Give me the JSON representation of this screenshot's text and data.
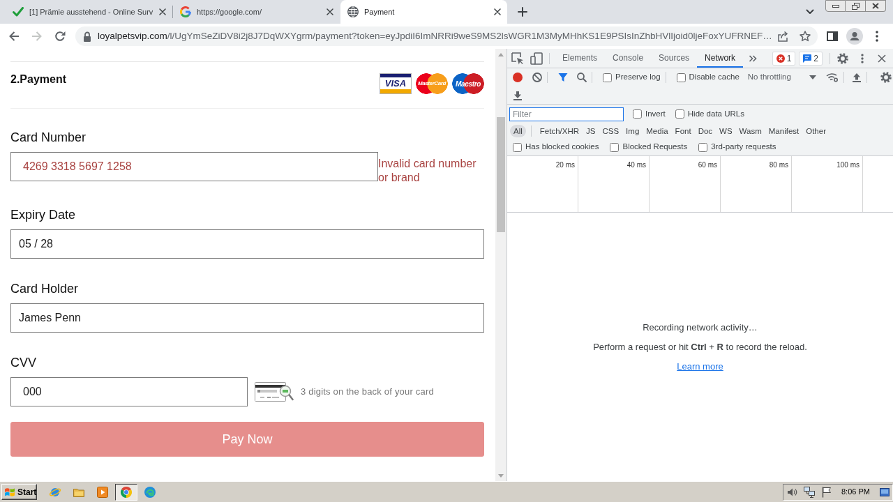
{
  "browser": {
    "tabs": [
      {
        "title": "[1] Prämie ausstehend - Online Surv",
        "kind": "check",
        "selected": false
      },
      {
        "title": "https://google.com/",
        "kind": "google",
        "selected": false
      },
      {
        "title": "Payment",
        "kind": "globe",
        "selected": true
      }
    ],
    "nav_buttons": [
      {
        "kind": "back",
        "disabled": false
      },
      {
        "kind": "forward",
        "disabled": true
      },
      {
        "kind": "reload",
        "disabled": false
      }
    ],
    "address": {
      "host": "loyalpetsvip.com",
      "path": "/l/UgYmSeZiDV8i2j8J7DqWXYgrm/payment?token=eyJpdiI6ImNRRi9weS9MS2lsWGR1M3MyMHhKS1E9PSIsInZhbHVlIjoid0ljeFoxYUFRNEF…"
    }
  },
  "page": {
    "section_title": "2.Payment",
    "card_logos": [
      {
        "kind": "visa",
        "label": "VISA"
      },
      {
        "kind": "mastercard",
        "label": "MasterCard"
      },
      {
        "kind": "maestro",
        "label": "Maestro"
      }
    ],
    "fields": [
      {
        "label": "Card Number",
        "value": "4269 3318 5697 1258",
        "invalid": true,
        "error": "Invalid card number or brand"
      },
      {
        "label": "Expiry Date",
        "value": "05 / 28",
        "invalid": false
      },
      {
        "label": "Card Holder",
        "value": "James Penn",
        "invalid": false
      },
      {
        "label": "CVV",
        "value": "000",
        "invalid": false,
        "hint": "3 digits on the back of your card"
      }
    ],
    "pay_button": {
      "label": "Pay Now",
      "disabled": true
    }
  },
  "devtools": {
    "tabs": [
      {
        "label": "Elements",
        "selected": false
      },
      {
        "label": "Console",
        "selected": false
      },
      {
        "label": "Sources",
        "selected": false
      },
      {
        "label": "Network",
        "selected": true
      }
    ],
    "issues": {
      "errors": "1",
      "messages": "2"
    },
    "toolbar": {
      "checkboxes": [
        {
          "label": "Preserve log",
          "checked": false
        },
        {
          "label": "Disable cache",
          "checked": false
        }
      ],
      "throttling": "No throttling"
    },
    "filter": {
      "placeholder": "Filter",
      "options": [
        {
          "label": "Invert",
          "checked": false
        },
        {
          "label": "Hide data URLs",
          "checked": false
        }
      ]
    },
    "types": [
      {
        "label": "All",
        "selected": true
      },
      {
        "label": "Fetch/XHR",
        "selected": false
      },
      {
        "label": "JS",
        "selected": false
      },
      {
        "label": "CSS",
        "selected": false
      },
      {
        "label": "Img",
        "selected": false
      },
      {
        "label": "Media",
        "selected": false
      },
      {
        "label": "Font",
        "selected": false
      },
      {
        "label": "Doc",
        "selected": false
      },
      {
        "label": "WS",
        "selected": false
      },
      {
        "label": "Wasm",
        "selected": false
      },
      {
        "label": "Manifest",
        "selected": false
      },
      {
        "label": "Other",
        "selected": false
      }
    ],
    "request_filters": [
      {
        "label": "Has blocked cookies",
        "checked": false
      },
      {
        "label": "Blocked Requests",
        "checked": false
      },
      {
        "label": "3rd-party requests",
        "checked": false
      }
    ],
    "timeline": {
      "ticks": [
        "20 ms",
        "40 ms",
        "60 ms",
        "80 ms",
        "100 ms"
      ]
    },
    "empty_state": {
      "title": "Recording network activity…",
      "hint": "Perform a request or hit **Ctrl** + **R** to record the reload.",
      "link": "Learn more"
    }
  },
  "taskbar": {
    "start": "Start",
    "apps": [
      {
        "kind": "ie",
        "active": false
      },
      {
        "kind": "folder",
        "active": false
      },
      {
        "kind": "media",
        "active": false
      },
      {
        "kind": "chrome",
        "active": true
      },
      {
        "kind": "edge",
        "active": false
      }
    ],
    "clock": "8:06 PM"
  }
}
